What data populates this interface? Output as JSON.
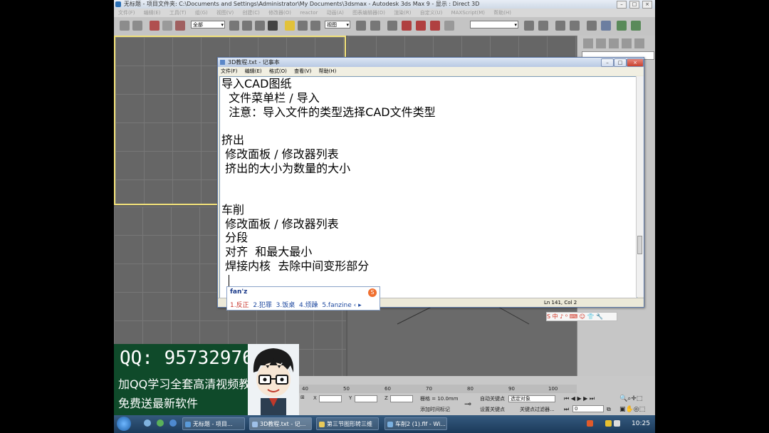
{
  "max_window": {
    "title": "无标题 - 项目文件夹: C:\\Documents and Settings\\Administrator\\My Documents\\3dsmax - Autodesk 3ds Max 9 - 显示 : Direct 3D",
    "menu": [
      "文件(F)",
      "编辑(E)",
      "工具(T)",
      "组(G)",
      "视图(V)",
      "创建(C)",
      "修改器(O)",
      "reactor",
      "动画(A)",
      "图表编辑器(D)",
      "渲染(R)",
      "自定义(U)",
      "MAXScript(M)",
      "帮助(H)"
    ],
    "toolbar": {
      "selection_filter": "全部",
      "ref_coord": "视图"
    }
  },
  "notepad": {
    "title": "3D教程.txt - 记事本",
    "menu": [
      "文件(F)",
      "编辑(E)",
      "格式(O)",
      "查看(V)",
      "帮助(H)"
    ],
    "lines": [
      "导入CAD图纸",
      "  文件菜单栏 / 导入",
      "  注意：导入文件的类型选择CAD文件类型",
      "",
      "挤出",
      " 修改面板 / 修改器列表",
      " 挤出的大小为数量的大小",
      "",
      "",
      "车削",
      " 修改面板 / 修改器列表",
      " 分段",
      " 对齐  和最大最小",
      " 焊接内核  去除中间变形部分"
    ],
    "status": "Ln 141, Col 2"
  },
  "ime": {
    "composition": "fan'z",
    "candidates": [
      "1.反正",
      "2.犯罪",
      "3.饭桌",
      "4.烦躁",
      "5.fanzine"
    ],
    "bar": "中 ♪ ⁰ ⌨ ☺ 👕 🔧"
  },
  "timeline": {
    "ticks": [
      "40",
      "50",
      "60",
      "70",
      "80",
      "90",
      "100"
    ]
  },
  "status": {
    "x_label": "X",
    "y_label": "Y",
    "z_label": "Z",
    "grid": "栅格 = 10.0mm",
    "add_time_tag": "添加时间标记",
    "auto_key": "自动关键点",
    "set_key": "设置关键点",
    "selected": "选定对象",
    "key_filters": "关键点过滤器...",
    "frame": "0"
  },
  "promo": {
    "qq": "QQ: 95732976",
    "line2": "加QQ学习全套高清视频教程",
    "line3": "免费送最新软件"
  },
  "taskbar": {
    "tasks": [
      "无标题 - 项目...",
      "3D教程.txt - 记...",
      "第三节图形转三维",
      "车削2 (1).flf - Wi..."
    ],
    "clock": "10:25"
  }
}
